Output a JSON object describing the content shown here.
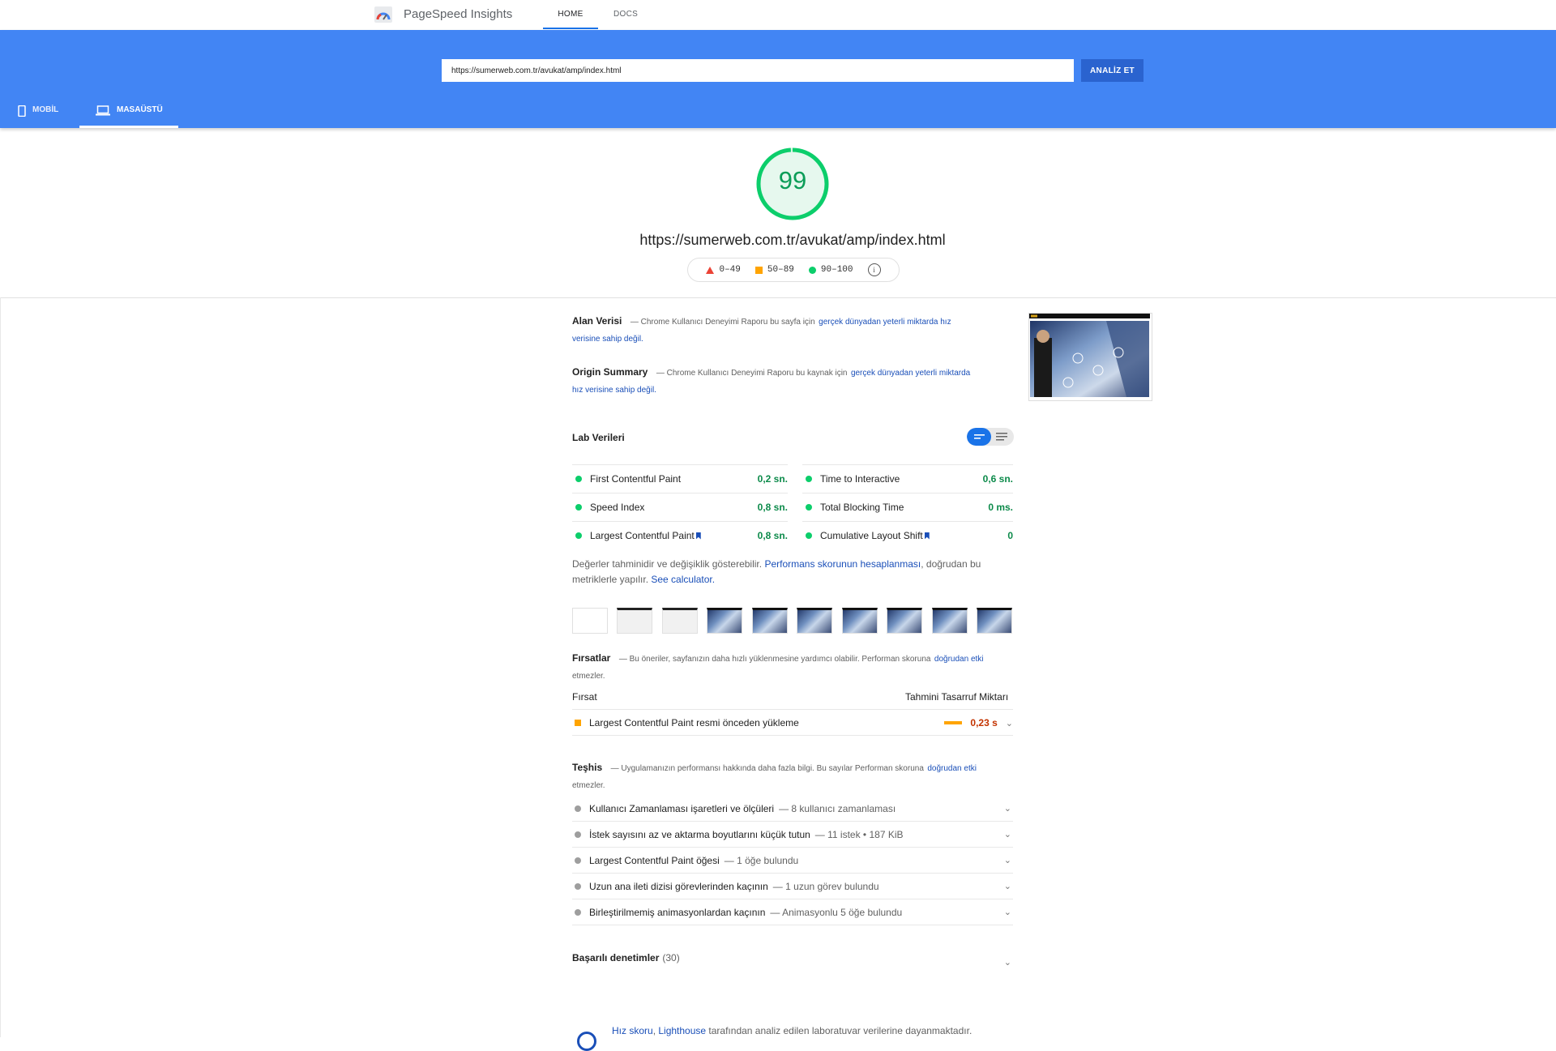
{
  "nav": {
    "brand": "PageSpeed Insights",
    "tabs": [
      {
        "label": "HOME"
      },
      {
        "label": "DOCS"
      }
    ]
  },
  "search": {
    "url_value": "https://sumerweb.com.tr/avukat/amp/index.html",
    "analyze_label": "ANALİZ ET"
  },
  "device_tabs": [
    {
      "label": "MOBİL"
    },
    {
      "label": "MASAÜSTÜ"
    }
  ],
  "score": {
    "value": "99",
    "fraction": 0.99,
    "url": "https://sumerweb.com.tr/avukat/amp/index.html",
    "legend": [
      "0–49",
      "50–89",
      "90–100"
    ],
    "colors": {
      "fail": "#eb4336",
      "average": "#ffa400",
      "pass": "#0cce6b"
    }
  },
  "field": {
    "title": "Alan Verisi",
    "text": "— Chrome Kullanıcı Deneyimi Raporu bu sayfa için",
    "link": "gerçek dünyadan yeterli miktarda hız verisine sahip değil."
  },
  "origin": {
    "title": "Origin Summary",
    "text": "— Chrome Kullanıcı Deneyimi Raporu bu kaynak için",
    "link": "gerçek dünyadan yeterli miktarda hız verisine sahip değil."
  },
  "lab": {
    "title": "Lab Verileri",
    "metrics": [
      {
        "label": "First Contentful Paint",
        "value": "0,2 sn."
      },
      {
        "label": "Time to Interactive",
        "value": "0,6 sn."
      },
      {
        "label": "Speed Index",
        "value": "0,8 sn."
      },
      {
        "label": "Total Blocking Time",
        "value": "0 ms."
      },
      {
        "label": "Largest Contentful Paint",
        "value": "0,8 sn."
      },
      {
        "label": "Cumulative Layout Shift",
        "value": "0"
      }
    ],
    "estimate_text": "Değerler tahminidir ve değişiklik gösterebilir.",
    "estimate_link": "Performans skorunun hesaplanması",
    "estimate_text2": ", doğrudan bu metriklerle yapılır.",
    "calculator_link": "See calculator."
  },
  "opportunities": {
    "title": "Fırsatlar",
    "text": "— Bu öneriler, sayfanızın daha hızlı yüklenmesine yardımcı olabilir. Performan skoruna",
    "link": "doğrudan etki",
    "text2": "etmezler.",
    "col_left": "Fırsat",
    "col_right": "Tahmini Tasarruf Miktarı",
    "items": [
      {
        "label": "Largest Contentful Paint resmi önceden yükleme",
        "value": "0,23 s"
      }
    ]
  },
  "diagnostics": {
    "title": "Teşhis",
    "text": "— Uygulamanızın performansı hakkında daha fazla bilgi. Bu sayılar Performan skoruna",
    "link": "doğrudan etki",
    "text2": "etmezler.",
    "items": [
      {
        "label": "Kullanıcı Zamanlaması işaretleri ve ölçüleri",
        "detail": "— 8 kullanıcı zamanlaması"
      },
      {
        "label": "İstek sayısını az ve aktarma boyutlarını küçük tutun",
        "detail": "— 11 istek • 187 KiB"
      },
      {
        "label": "Largest Contentful Paint öğesi",
        "detail": "— 1 öğe bulundu"
      },
      {
        "label": "Uzun ana ileti dizisi görevlerinden kaçının",
        "detail": "— 1 uzun görev bulundu"
      },
      {
        "label": "Birleştirilmemiş animasyonlardan kaçının",
        "detail": "— Animasyonlu 5 öğe bulundu"
      }
    ]
  },
  "passed": {
    "title": "Başarılı denetimler",
    "count": "(30)"
  },
  "footer": {
    "link1": "Hız skoru",
    "sep": ", ",
    "link2": "Lighthouse",
    "text": "tarafından analiz edilen laboratuvar verilerine dayanmaktadır."
  }
}
